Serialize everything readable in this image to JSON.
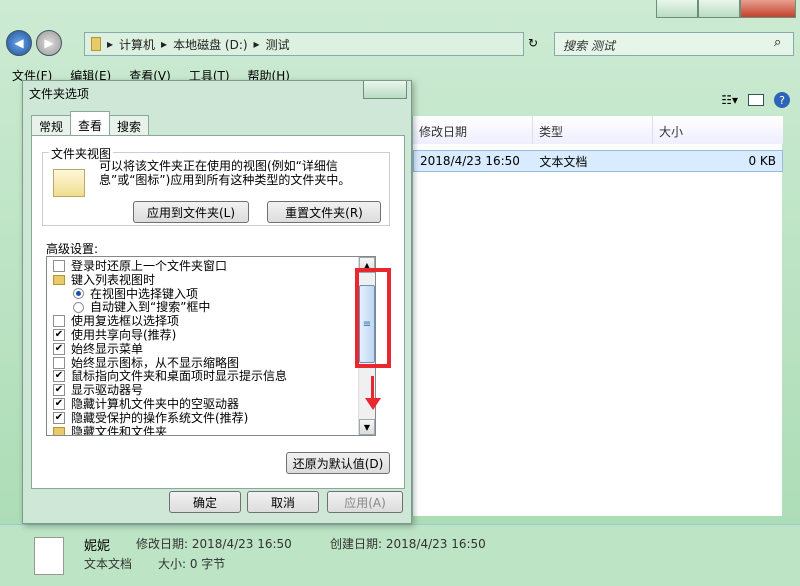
{
  "breadcrumb": [
    "计算机",
    "本地磁盘 (D:)",
    "测试"
  ],
  "search_placeholder": "搜索 测试",
  "menu": [
    "文件(F)",
    "编辑(E)",
    "查看(V)",
    "工具(T)",
    "帮助(H)"
  ],
  "columns": [
    "修改日期",
    "类型",
    "大小"
  ],
  "file_row": {
    "date": "2018/4/23 16:50",
    "type": "文本文档",
    "size": "0 KB"
  },
  "details": {
    "name": "妮妮",
    "modified": "修改日期: 2018/4/23 16:50",
    "created": "创建日期: 2018/4/23 16:50",
    "type": "文本文档",
    "size": "大小: 0 字节"
  },
  "dialog": {
    "title": "文件夹选项",
    "tabs": [
      "常规",
      "查看",
      "搜索"
    ],
    "group_label": "文件夹视图",
    "group_text": "可以将该文件夹正在使用的视图(例如“详细信息”或“图标”)应用到所有这种类型的文件夹中。",
    "btn_apply_folders": "应用到文件夹(L)",
    "btn_reset_folders": "重置文件夹(R)",
    "adv_label": "高级设置:",
    "tree": [
      {
        "kind": "cb",
        "checked": false,
        "indent": 0,
        "text": "登录时还原上一个文件夹窗口"
      },
      {
        "kind": "folder",
        "indent": 0,
        "text": "键入列表视图时"
      },
      {
        "kind": "rb",
        "checked": true,
        "indent": 1,
        "text": "在视图中选择键入项"
      },
      {
        "kind": "rb",
        "checked": false,
        "indent": 1,
        "text": "自动键入到“搜索”框中"
      },
      {
        "kind": "cb",
        "checked": false,
        "indent": 0,
        "text": "使用复选框以选择项"
      },
      {
        "kind": "cb",
        "checked": true,
        "indent": 0,
        "text": "使用共享向导(推荐)"
      },
      {
        "kind": "cb",
        "checked": true,
        "indent": 0,
        "text": "始终显示菜单"
      },
      {
        "kind": "cb",
        "checked": false,
        "indent": 0,
        "text": "始终显示图标，从不显示缩略图"
      },
      {
        "kind": "cb",
        "checked": true,
        "indent": 0,
        "text": "鼠标指向文件夹和桌面项时显示提示信息"
      },
      {
        "kind": "cb",
        "checked": true,
        "indent": 0,
        "text": "显示驱动器号"
      },
      {
        "kind": "cb",
        "checked": true,
        "indent": 0,
        "text": "隐藏计算机文件夹中的空驱动器"
      },
      {
        "kind": "cb",
        "checked": true,
        "indent": 0,
        "text": "隐藏受保护的操作系统文件(推荐)"
      },
      {
        "kind": "folder",
        "indent": 0,
        "text": "隐藏文件和文件夹"
      }
    ],
    "btn_restore": "还原为默认值(D)",
    "btn_ok": "确定",
    "btn_cancel": "取消",
    "btn_apply": "应用(A)"
  }
}
